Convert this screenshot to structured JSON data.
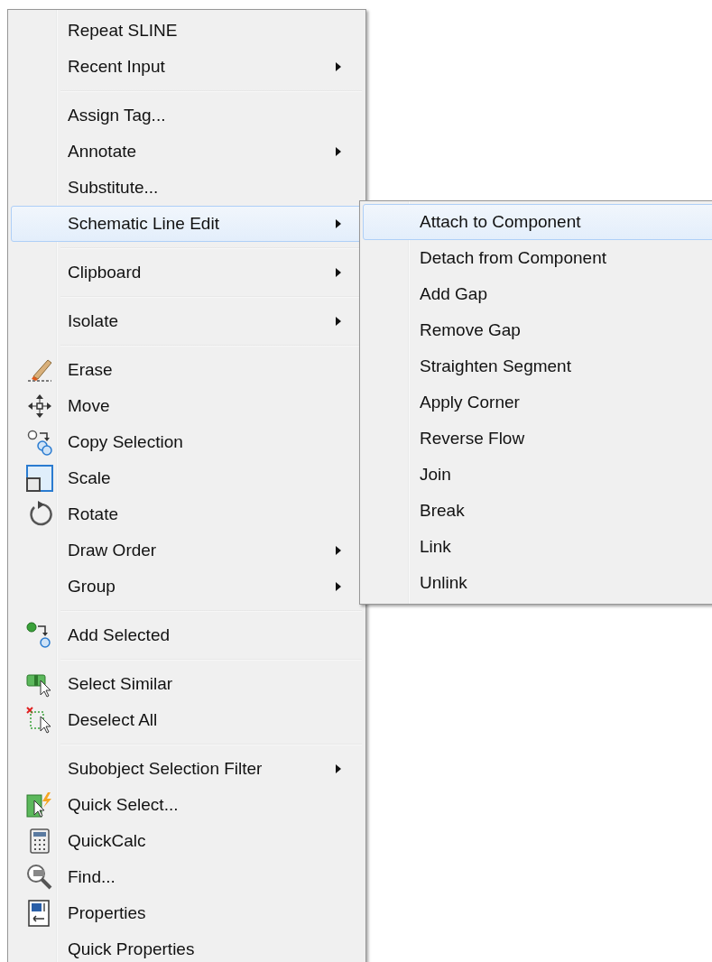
{
  "menu": {
    "sections": [
      [
        {
          "label": "Repeat SLINE",
          "has_submenu": false,
          "selected": false
        },
        {
          "label": "Recent Input",
          "has_submenu": true,
          "selected": false
        }
      ],
      [
        {
          "label": "Assign Tag...",
          "has_submenu": false,
          "selected": false
        },
        {
          "label": "Annotate",
          "has_submenu": true,
          "selected": false
        },
        {
          "label": "Substitute...",
          "has_submenu": false,
          "selected": false
        },
        {
          "label": "Schematic Line Edit",
          "has_submenu": true,
          "selected": true
        }
      ],
      [
        {
          "label": "Clipboard",
          "has_submenu": true,
          "selected": false
        }
      ],
      [
        {
          "label": "Isolate",
          "has_submenu": true,
          "selected": false
        }
      ],
      [
        {
          "label": "Erase",
          "has_submenu": false,
          "selected": false
        },
        {
          "label": "Move",
          "has_submenu": false,
          "selected": false
        },
        {
          "label": "Copy Selection",
          "has_submenu": false,
          "selected": false
        },
        {
          "label": "Scale",
          "has_submenu": false,
          "selected": false
        },
        {
          "label": "Rotate",
          "has_submenu": false,
          "selected": false
        },
        {
          "label": "Draw Order",
          "has_submenu": true,
          "selected": false
        },
        {
          "label": "Group",
          "has_submenu": true,
          "selected": false
        }
      ],
      [
        {
          "label": "Add Selected",
          "has_submenu": false,
          "selected": false
        }
      ],
      [
        {
          "label": "Select Similar",
          "has_submenu": false,
          "selected": false
        },
        {
          "label": "Deselect All",
          "has_submenu": false,
          "selected": false
        }
      ],
      [
        {
          "label": "Subobject Selection Filter",
          "has_submenu": true,
          "selected": false
        },
        {
          "label": "Quick Select...",
          "has_submenu": false,
          "selected": false
        },
        {
          "label": "QuickCalc",
          "has_submenu": false,
          "selected": false
        },
        {
          "label": "Find...",
          "has_submenu": false,
          "selected": false
        },
        {
          "label": "Properties",
          "has_submenu": false,
          "selected": false
        },
        {
          "label": "Quick Properties",
          "has_submenu": false,
          "selected": false
        }
      ]
    ]
  },
  "submenu": {
    "items": [
      {
        "label": "Attach to Component",
        "selected": true
      },
      {
        "label": "Detach from Component",
        "selected": false
      },
      {
        "label": "Add Gap",
        "selected": false
      },
      {
        "label": "Remove Gap",
        "selected": false
      },
      {
        "label": "Straighten Segment",
        "selected": false
      },
      {
        "label": "Apply Corner",
        "selected": false
      },
      {
        "label": "Reverse Flow",
        "selected": false
      },
      {
        "label": "Join",
        "selected": false
      },
      {
        "label": "Break",
        "selected": false
      },
      {
        "label": "Link",
        "selected": false
      },
      {
        "label": "Unlink",
        "selected": false
      }
    ]
  }
}
